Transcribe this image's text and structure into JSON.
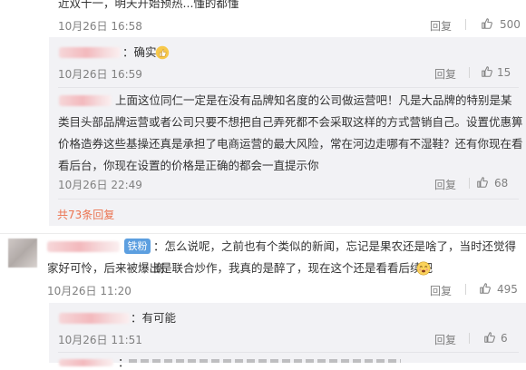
{
  "comments": {
    "top_tail": {
      "text": "近双十一，明天开始预热...懂的都懂",
      "time": "10月26日 16:58",
      "reply_label": "回复",
      "likes": "500"
    },
    "replies": [
      {
        "text": "：确实",
        "emoji": "thumbs-up",
        "time": "10月26日 16:59",
        "reply_label": "回复",
        "likes": "15"
      },
      {
        "text_line1": "上面这位同仁一定是在没有品牌知名度的公司做运营吧！凡是大品牌的特别是某",
        "text_line2": "类目头部品牌运营或者公司只要不想把自己弄死都不会采取这样的方式营销自己。设置优惠箅",
        "text_line3": "价格造券这些基操还真是承担了电商运营的最大风险，常在河边走哪有不湿鞋？还有你现在看",
        "text_line4": "看后台，你现在设置的价格是正确的都会一直提示你",
        "time": "10月26日 22:49",
        "reply_label": "回复",
        "likes": "68"
      }
    ],
    "more_replies": "共73条回复",
    "second": {
      "badge": "铁粉",
      "text_line1": "：怎么说呢，之前也有个类似的新闻，忘记是果农还是啥了，当时还觉得商",
      "text_line2": "家好可怜，后来被爆出是联合炒作，我真的是醉了，现在这个还是看看后续吧",
      "time": "10月26日 11:20",
      "reply_label": "回复",
      "likes": "495"
    },
    "second_replies": [
      {
        "text": "：有可能",
        "time": "10月26日 11:51",
        "reply_label": "回复",
        "likes": "6"
      },
      {
        "text": "："
      }
    ]
  },
  "colors": {
    "link": "#eb7350",
    "time": "#808080",
    "sub_bg": "#f2f2f5"
  }
}
